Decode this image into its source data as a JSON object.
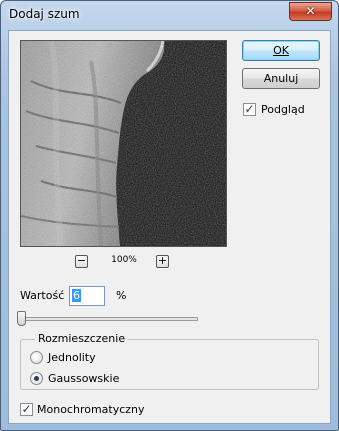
{
  "window": {
    "title": "Dodaj szum",
    "close_glyph": "✕"
  },
  "preview": {
    "zoom": "100%",
    "zoom_out_glyph": "−",
    "zoom_in_glyph": "+"
  },
  "buttons": {
    "ok": "OK",
    "cancel": "Anuluj"
  },
  "preview_toggle": {
    "label": "Podgląd",
    "checked": true,
    "check_glyph": "✓"
  },
  "amount": {
    "label": "Wartość",
    "value": "6",
    "unit": "%",
    "slider_fraction": 0.012
  },
  "distribution": {
    "legend": "Rozmieszczenie",
    "options": [
      {
        "label": "Jednolity",
        "selected": false
      },
      {
        "label": "Gaussowskie",
        "selected": true
      }
    ]
  },
  "monochromatic": {
    "label": "Monochromatyczny",
    "checked": true,
    "check_glyph": "✓"
  },
  "colors": {
    "accent": "#3399ff",
    "titlebar": "#aac4e2",
    "close": "#c33b24"
  }
}
